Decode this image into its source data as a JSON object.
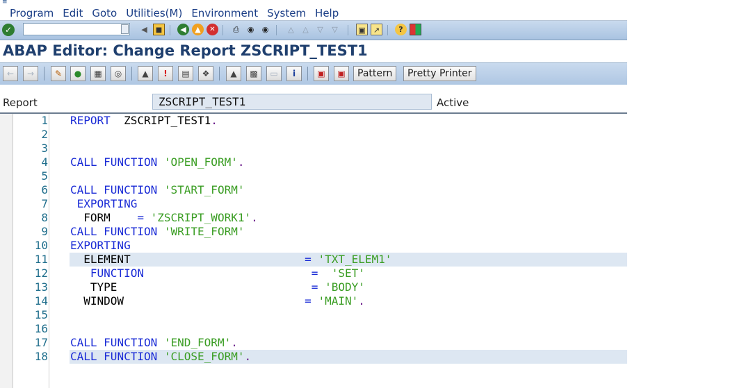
{
  "menu": {
    "items": [
      "Program",
      "Edit",
      "Goto",
      "Utilities(M)",
      "Environment",
      "System",
      "Help"
    ]
  },
  "std_toolbar": {
    "command_field_value": "",
    "icons": [
      "enter-icon",
      "back-icon",
      "save-icon",
      "back-nav-icon",
      "exit-icon",
      "cancel-icon",
      "print-icon",
      "find-icon",
      "find-next-icon",
      "first-page-icon",
      "previous-page-icon",
      "next-page-icon",
      "last-page-icon",
      "new-session-icon",
      "shortcut-icon",
      "help-icon",
      "layout-icon"
    ]
  },
  "title": "ABAP Editor: Change Report ZSCRIPT_TEST1",
  "app_toolbar": {
    "pattern_label": "Pattern",
    "pretty_printer_label": "Pretty Printer"
  },
  "report_line": {
    "label": "Report",
    "name": "ZSCRIPT_TEST1",
    "status": "Active"
  },
  "code": {
    "lines": [
      {
        "n": "1",
        "text": "REPORT  ZSCRIPT_TEST1."
      },
      {
        "n": "2",
        "text": ""
      },
      {
        "n": "3",
        "text": ""
      },
      {
        "n": "4",
        "text": "CALL FUNCTION 'OPEN_FORM'."
      },
      {
        "n": "5",
        "text": ""
      },
      {
        "n": "6",
        "text": "CALL FUNCTION 'START_FORM'"
      },
      {
        "n": "7",
        "text": " EXPORTING"
      },
      {
        "n": "8",
        "text": "  FORM    = 'ZSCRIPT_WORK1'."
      },
      {
        "n": "9",
        "text": "CALL FUNCTION 'WRITE_FORM'"
      },
      {
        "n": "10",
        "text": "EXPORTING"
      },
      {
        "n": "11",
        "text": "  ELEMENT                          = 'TXT_ELEM1'"
      },
      {
        "n": "12",
        "text": "   FUNCTION                         =  'SET'"
      },
      {
        "n": "13",
        "text": "   TYPE                             = 'BODY'"
      },
      {
        "n": "14",
        "text": "  WINDOW                           = 'MAIN'."
      },
      {
        "n": "15",
        "text": ""
      },
      {
        "n": "16",
        "text": ""
      },
      {
        "n": "17",
        "text": "CALL FUNCTION 'END_FORM'."
      },
      {
        "n": "18",
        "text": "CALL FUNCTION 'CLOSE_FORM'."
      }
    ],
    "highlighted_lines": [
      "11",
      "18"
    ]
  },
  "colors": {
    "keyword": "#1a2bd6",
    "string": "#3a9d23",
    "line_number": "#1f6e8c",
    "title": "#1f3f6e",
    "highlight": "#dde7f2"
  }
}
